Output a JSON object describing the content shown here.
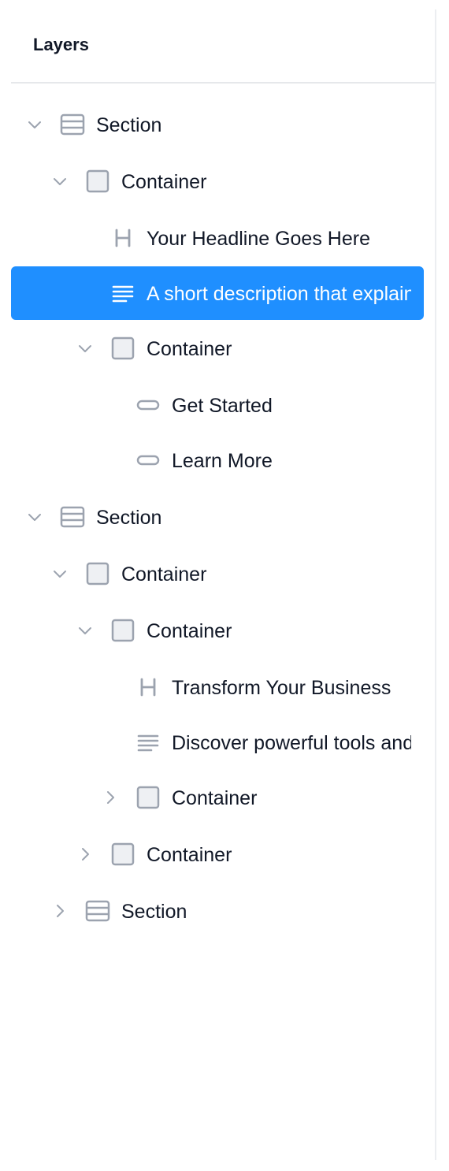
{
  "panel": {
    "title": "Layers"
  },
  "colors": {
    "selected_background": "#1f8fff",
    "icon_gray": "#9ca3af",
    "text": "#111827"
  },
  "layers": [
    {
      "label": "Section",
      "icon": "section-icon",
      "chevron": "expanded",
      "selected": false
    },
    {
      "label": "Container",
      "icon": "container-icon",
      "chevron": "expanded",
      "selected": false
    },
    {
      "label": "Your Headline Goes Here",
      "icon": "heading-icon",
      "chevron": "none",
      "selected": false
    },
    {
      "label": "A short description that explains",
      "icon": "paragraph-icon",
      "chevron": "none",
      "selected": true
    },
    {
      "label": "Container",
      "icon": "container-icon",
      "chevron": "expanded",
      "selected": false
    },
    {
      "label": "Get Started",
      "icon": "button-icon",
      "chevron": "none",
      "selected": false
    },
    {
      "label": "Learn More",
      "icon": "button-icon",
      "chevron": "none",
      "selected": false
    },
    {
      "label": "Section",
      "icon": "section-icon",
      "chevron": "expanded",
      "selected": false
    },
    {
      "label": "Container",
      "icon": "container-icon",
      "chevron": "expanded",
      "selected": false
    },
    {
      "label": "Container",
      "icon": "container-icon",
      "chevron": "expanded",
      "selected": false
    },
    {
      "label": "Transform Your Business",
      "icon": "heading-icon",
      "chevron": "none",
      "selected": false
    },
    {
      "label": "Discover powerful tools and",
      "icon": "paragraph-icon",
      "chevron": "none",
      "selected": false
    },
    {
      "label": "Container",
      "icon": "container-icon",
      "chevron": "collapsed",
      "selected": false
    },
    {
      "label": "Container",
      "icon": "container-icon",
      "chevron": "collapsed",
      "selected": false
    },
    {
      "label": "Section",
      "icon": "section-icon",
      "chevron": "collapsed",
      "selected": false
    }
  ]
}
